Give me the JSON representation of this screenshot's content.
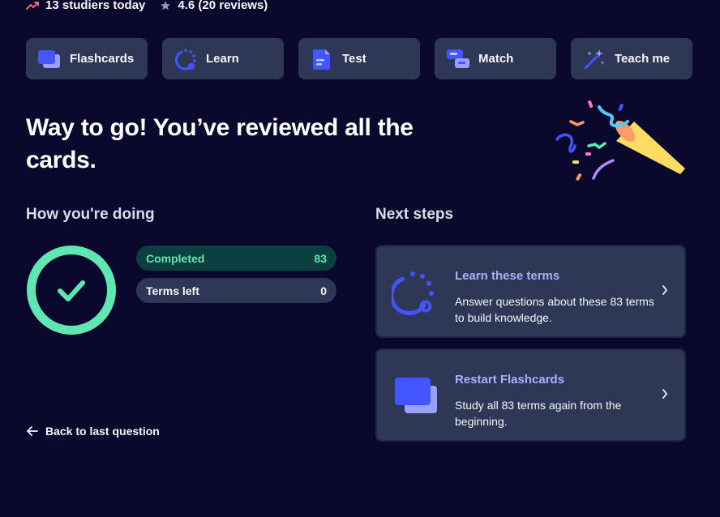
{
  "topbar": {
    "studiers": "13 studiers today",
    "rating": "4.6 (20 reviews)"
  },
  "modes": [
    {
      "label": "Flashcards",
      "icon": "flashcards-icon"
    },
    {
      "label": "Learn",
      "icon": "learn-icon"
    },
    {
      "label": "Test",
      "icon": "test-icon"
    },
    {
      "label": "Match",
      "icon": "match-icon"
    },
    {
      "label": "Teach me",
      "icon": "magic-wand-icon"
    }
  ],
  "headline": "Way to go! You’ve reviewed all the cards.",
  "progress": {
    "title": "How you're doing",
    "completed_label": "Completed",
    "completed_value": "83",
    "left_label": "Terms left",
    "left_value": "0"
  },
  "next_steps": {
    "title": "Next steps",
    "items": [
      {
        "title": "Learn these terms",
        "desc": "Answer questions about these 83 terms to build knowledge.",
        "icon": "learn-icon"
      },
      {
        "title": "Restart Flashcards",
        "desc": "Study all 83 terms again from the beginning.",
        "icon": "flashcards-icon"
      }
    ]
  },
  "back_link": "Back to last question",
  "colors": {
    "background": "#0a092d",
    "card": "#2e3856",
    "accent": "#4255ff",
    "success": "#60e6b0",
    "link": "#a8b1ff"
  }
}
